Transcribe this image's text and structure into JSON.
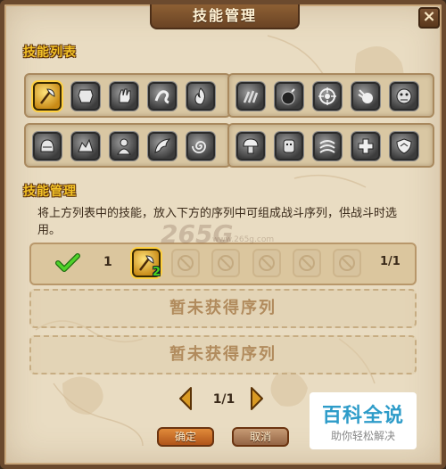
{
  "window": {
    "title": "技能管理",
    "close_label": "×"
  },
  "skill_list": {
    "label": "技能列表",
    "left_panel": {
      "row1": [
        "axe-skill-icon",
        "armor-skill-icon",
        "glove-skill-icon",
        "dragon-skill-icon",
        "flame-skill-icon"
      ],
      "row2": [
        "helmet-skill-icon",
        "beast-skill-icon",
        "warrior-skill-icon",
        "wing-skill-icon",
        "spiral-skill-icon"
      ]
    },
    "right_panel": {
      "row1": [
        "claw-skill-icon",
        "bomb-skill-icon",
        "target-skill-icon",
        "fireball-skill-icon",
        "ogre-skill-icon"
      ],
      "row2": [
        "mushroom-skill-icon",
        "golem-skill-icon",
        "whirl-skill-icon",
        "heal-cross-skill-icon",
        "shield-skill-icon"
      ]
    },
    "selected": "axe-skill-icon"
  },
  "skill_manage": {
    "label": "技能管理",
    "description": "将上方列表中的技能，放入下方的序列中可组成战斗序列，供战斗时选用。"
  },
  "sequence": {
    "active": true,
    "number": "1",
    "skill": {
      "icon": "axe-skill-icon",
      "level": "2"
    },
    "empty_slots": 5,
    "page": "1/1"
  },
  "empty_sequences": [
    "暂未获得序列",
    "暂未获得序列"
  ],
  "pagination": {
    "current": "1/1",
    "prev_icon": "arrow-left-icon",
    "next_icon": "arrow-right-icon"
  },
  "buttons": {
    "confirm": "确定",
    "cancel": "取消"
  },
  "watermark": {
    "text": "265G",
    "sub": "www.265g.com"
  },
  "badge": {
    "main": "百科全说",
    "sub": "助你轻松解决"
  },
  "colors": {
    "section_label": "#f3c227",
    "panel_bg": "#e9dcc2",
    "frame": "#6b4a2e",
    "badge_text": "#2e9cc9"
  }
}
